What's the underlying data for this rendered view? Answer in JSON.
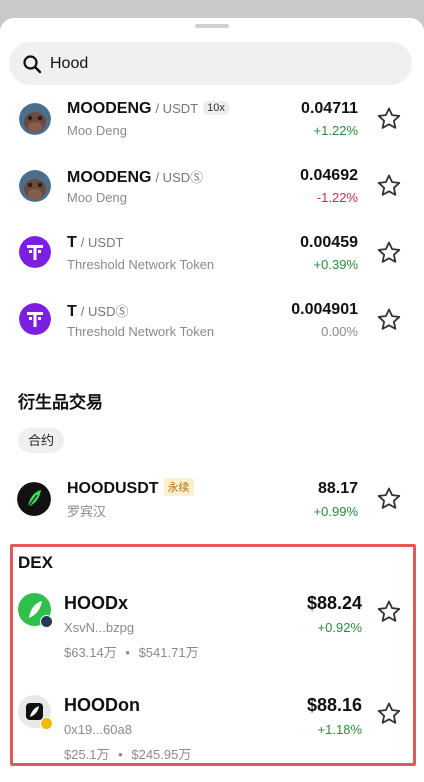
{
  "search": {
    "value": "Hood",
    "icon": "search-icon"
  },
  "spot": [
    {
      "symbol": "MOODENG",
      "quote": "/ USDT",
      "leverage": "10x",
      "name": "Moo Deng",
      "price": "0.04711",
      "change": "+1.22%",
      "dir": "up",
      "icon": "moodeng-logo-icon"
    },
    {
      "symbol": "MOODENG",
      "quote": "/ USDⓈ",
      "leverage": "",
      "name": "Moo Deng",
      "price": "0.04692",
      "change": "-1.22%",
      "dir": "down",
      "icon": "moodeng-logo-icon"
    },
    {
      "symbol": "T",
      "quote": "/ USDT",
      "leverage": "",
      "name": "Threshold Network Token",
      "price": "0.00459",
      "change": "+0.39%",
      "dir": "up",
      "icon": "threshold-logo-icon"
    },
    {
      "symbol": "T",
      "quote": "/ USDⓈ",
      "leverage": "",
      "name": "Threshold Network Token",
      "price": "0.004901",
      "change": "0.00%",
      "dir": "flat",
      "icon": "threshold-logo-icon"
    }
  ],
  "derivatives": {
    "title": "衍生品交易",
    "chip": "合约",
    "item": {
      "symbol": "HOODUSDT",
      "tag": "永续",
      "name": "罗宾汉",
      "price": "88.17",
      "change": "+0.99%"
    }
  },
  "dex": {
    "title": "DEX",
    "items": [
      {
        "name": "HOODx",
        "address": "XsvN...bzpg",
        "mcap": "$63.14万",
        "sep": "•",
        "volume": "$541.71万",
        "price": "$88.24",
        "change": "+0.92%"
      },
      {
        "name": "HOODon",
        "address": "0x19...60a8",
        "mcap": "$25.1万",
        "sep": "•",
        "volume": "$245.95万",
        "price": "$88.16",
        "change": "+1.18%"
      }
    ]
  },
  "colors": {
    "up": "#2b8a3e",
    "down": "#c0304e",
    "highlight": "#e05a5a"
  }
}
